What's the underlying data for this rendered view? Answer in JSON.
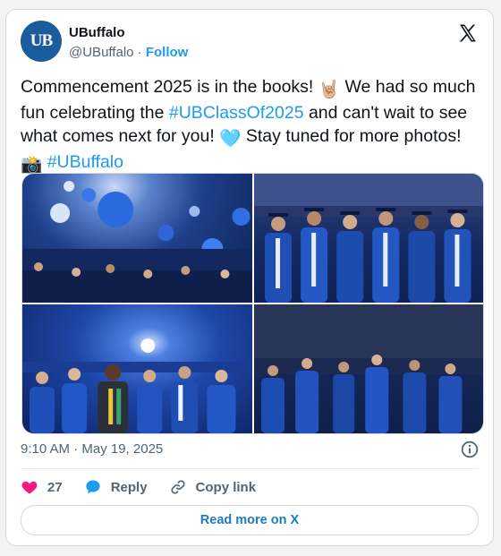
{
  "author": {
    "display_name": "UBuffalo",
    "handle": "@UBuffalo",
    "separator": "·",
    "follow_label": "Follow",
    "avatar_text": "UB"
  },
  "tweet": {
    "text_1": "Commencement 2025 is in the books! ",
    "emoji_1": "🤘🏼",
    "text_2": " We had so much fun celebrating the ",
    "hashtag_1": "#UBClassOf2025",
    "text_3": " and can't wait to see what comes next for you! ",
    "emoji_2": "🩵",
    "text_4": " Stay tuned for more photos! ",
    "emoji_3": "📸",
    "text_5": " ",
    "hashtag_2": "#UBuffalo"
  },
  "timestamp": "9:10 AM · May 19, 2025",
  "actions": {
    "like_count": "27",
    "reply_label": "Reply",
    "copy_link_label": "Copy link"
  },
  "read_more_label": "Read more on X",
  "colors": {
    "link": "#1d9bf0",
    "like": "#f91880",
    "reply": "#1d9bf0",
    "avatar_bg": "#1a5c9c"
  },
  "icons": {
    "brand": "x-logo-icon",
    "info": "info-icon",
    "like": "heart-icon",
    "reply": "speech-bubble-icon",
    "copy_link": "link-icon"
  }
}
